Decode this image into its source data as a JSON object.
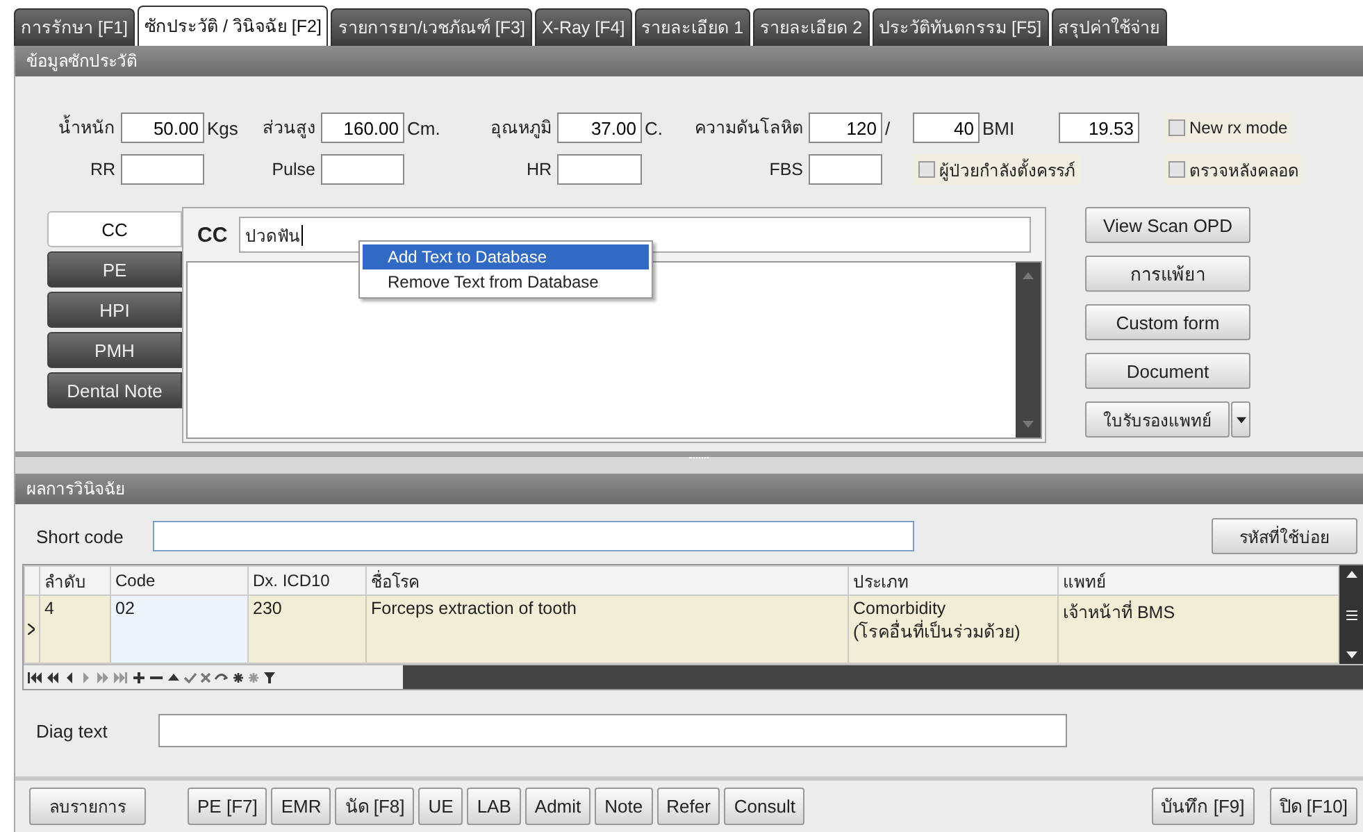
{
  "tabs": [
    {
      "label": "การรักษา [F1]",
      "selected": false
    },
    {
      "label": "ซักประวัติ / วินิจฉัย [F2]",
      "selected": true
    },
    {
      "label": "รายการยา/เวชภัณฑ์ [F3]",
      "selected": false
    },
    {
      "label": "X-Ray [F4]",
      "selected": false
    },
    {
      "label": "รายละเอียด 1",
      "selected": false
    },
    {
      "label": "รายละเอียด 2",
      "selected": false
    },
    {
      "label": "ประวัติทันตกรรม [F5]",
      "selected": false
    },
    {
      "label": "สรุปค่าใช้จ่าย",
      "selected": false
    }
  ],
  "history_section": {
    "title": "ข้อมูลซักประวัติ",
    "vitals": [
      [
        {
          "kind": "label",
          "text": "น้ำหนัก"
        },
        {
          "kind": "field",
          "value": "50.00"
        },
        {
          "kind": "unit",
          "text": "Kgs"
        },
        {
          "kind": "label",
          "text": "ส่วนสูง"
        },
        {
          "kind": "field",
          "value": "160.00"
        },
        {
          "kind": "unit",
          "text": "Cm."
        },
        {
          "kind": "label",
          "text": "อุณหภูมิ"
        },
        {
          "kind": "field",
          "value": "37.00"
        },
        {
          "kind": "unit",
          "text": "C."
        },
        {
          "kind": "label",
          "text": "ความดันโลหิต"
        },
        {
          "kind": "field",
          "value": "120"
        },
        {
          "kind": "unit",
          "text": "/"
        },
        {
          "kind": "field",
          "value": "40"
        },
        {
          "kind": "unit",
          "text": "BMI"
        },
        {
          "kind": "field",
          "value": "19.53"
        },
        {
          "kind": "checkbox",
          "label": "New rx mode",
          "checked": false
        }
      ],
      [
        {
          "kind": "label",
          "text": "RR"
        },
        {
          "kind": "field"
        },
        {
          "kind": "label",
          "text": "Pulse"
        },
        {
          "kind": "field"
        },
        {
          "kind": "label",
          "text": "HR"
        },
        {
          "kind": "field"
        },
        {
          "kind": "label",
          "text": "FBS"
        },
        {
          "kind": "field"
        },
        {
          "kind": "checkbox",
          "label": "ผู้ป่วยกำลังตั้งครรภ์",
          "checked": false
        },
        {
          "kind": "checkbox",
          "label": "ตรวจหลังคลอด",
          "checked": false
        }
      ]
    ]
  },
  "note_tabs": [
    {
      "label": "CC",
      "selected": true
    },
    {
      "label": "PE",
      "selected": false
    },
    {
      "label": "HPI",
      "selected": false
    },
    {
      "label": "PMH",
      "selected": false
    },
    {
      "label": "Dental Note",
      "selected": false
    }
  ],
  "note_editor": {
    "label": "CC",
    "value": "ปวดฟัน"
  },
  "context_menu": [
    {
      "label": "Add Text to Database",
      "selected": true
    },
    {
      "label": "Remove Text from Database",
      "selected": false
    }
  ],
  "side_buttons": [
    {
      "label": "View Scan OPD",
      "kind": "plain"
    },
    {
      "label": "การแพ้ยา",
      "kind": "plain"
    },
    {
      "label": "Custom form",
      "kind": "plain"
    },
    {
      "label": "Document",
      "kind": "plain"
    },
    {
      "label": "ใบรับรองแพทย์",
      "kind": "split"
    }
  ],
  "diagnosis_section": {
    "title": "ผลการวินิจฉัย",
    "short_code_label": "Short code",
    "frequent_codes_button": "รหัสที่ใช้บ่อย",
    "table": {
      "columns": [
        "ลำดับ",
        "Code",
        "Dx. ICD10",
        "ชื่อโรค",
        "ประเภท",
        "แพทย์"
      ],
      "rows": [
        {
          "selected": true,
          "cells": [
            "4",
            "02",
            "230",
            "Forceps extraction of tooth",
            "Comorbidity\n(โรคอื่นที่เป็นร่วมด้วย)",
            "เจ้าหน้าที่ BMS"
          ]
        }
      ]
    },
    "diag_text_label": "Diag text"
  },
  "bottom_buttons": {
    "left": [
      "ลบรายการ"
    ],
    "middle": [
      "PE [F7]",
      "EMR",
      "นัด [F8]",
      "UE",
      "LAB",
      "Admit",
      "Note",
      "Refer",
      "Consult"
    ],
    "right": [
      "บันทึก [F9]",
      "ปิด [F10]"
    ]
  }
}
